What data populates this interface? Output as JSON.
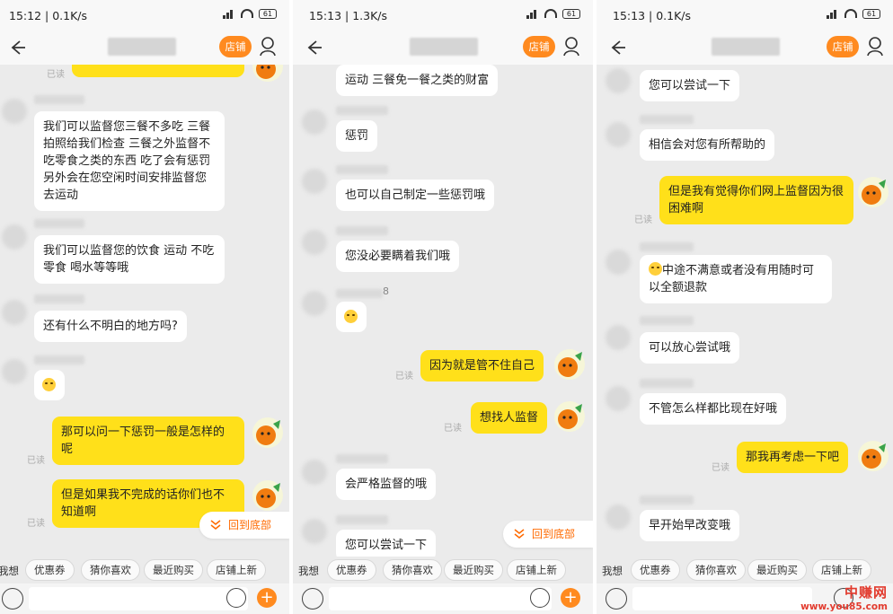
{
  "status": {
    "panel1": {
      "time": "15:12",
      "speed": "0.1K/s",
      "battery": "61"
    },
    "panel2": {
      "time": "15:13",
      "speed": "1.3K/s",
      "battery": "61"
    },
    "panel3": {
      "time": "15:13",
      "speed": "0.1K/s",
      "battery": "61"
    }
  },
  "header": {
    "shop_label": "店铺"
  },
  "read_label": "已读",
  "scroll_bottom_label": "回到底部",
  "quick_bar": {
    "label": "我想",
    "chips": [
      "优惠券",
      "猜你喜欢",
      "最近购买",
      "店铺上新"
    ]
  },
  "panel1": {
    "top_partial": "...",
    "messages": [
      "我们可以监督您三餐不多吃 三餐拍照给我们检查 三餐之外监督不吃零食之类的东西 吃了会有惩罚 另外会在您空闲时间安排监督您去运动",
      "我们可以监督您的饮食 运动 不吃零食 喝水等等哦",
      "还有什么不明白的地方吗?",
      "",
      "那可以问一下惩罚一般是怎样的呢",
      "但是如果我不完成的话你们也不知道啊"
    ]
  },
  "panel2": {
    "messages": [
      "运动 三餐免一餐之类的财富",
      "惩罚",
      "也可以自己制定一些惩罚哦",
      "您没必要瞒着我们哦",
      "",
      "因为就是管不住自己",
      "想找人监督",
      "会严格监督的哦",
      "您可以尝试一下"
    ],
    "name_suffix": "8"
  },
  "panel3": {
    "messages": [
      "您可以尝试一下",
      "相信会对您有所帮助的",
      "但是我有觉得你们网上监督因为很困难啊",
      "中途不满意或者没有用随时可以全额退款",
      "可以放心尝试哦",
      "不管怎么样都比现在好哦",
      "那我再考虑一下吧",
      "早开始早改变哦"
    ]
  },
  "watermark": {
    "title": "中赚网",
    "url": "www.you85.com"
  },
  "colors": {
    "accent": "#ff8a1f",
    "bubble_out": "#ffe01a",
    "bubble_in": "#ffffff",
    "background": "#ebebeb"
  }
}
